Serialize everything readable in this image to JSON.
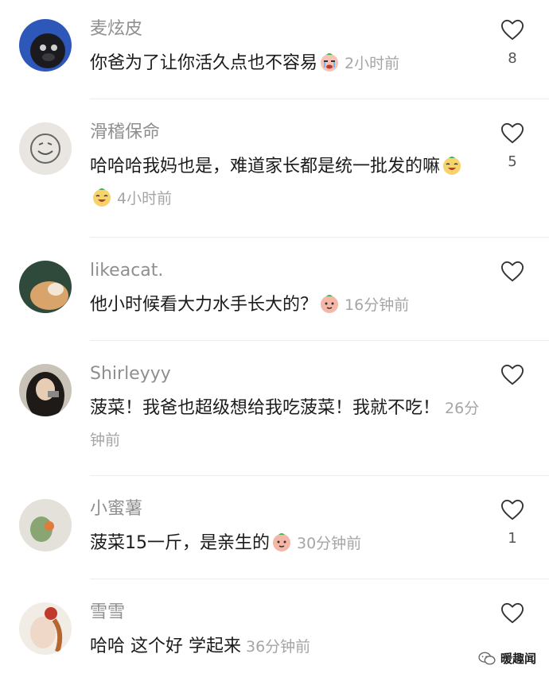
{
  "comments": [
    {
      "username": "麦炫皮",
      "text": "你爸为了让你活久点也不容易",
      "emoji": "crying-face-emoji",
      "time": "2小时前",
      "likes": "8"
    },
    {
      "username": "滑稽保命",
      "text": "哈哈哈我妈也是，难道家长都是统一批发的嘛",
      "emoji": "laughing-face-emoji",
      "time": "4小时前",
      "likes": "5"
    },
    {
      "username": "likeacat.",
      "text": "他小时候看大力水手长大的？",
      "emoji": "peach-face-emoji",
      "time": "16分钟前",
      "likes": ""
    },
    {
      "username": "Shirleyyy",
      "text": "菠菜！我爸也超级想给我吃菠菜！我就不吃！",
      "emoji": "",
      "time": "26分钟前",
      "likes": ""
    },
    {
      "username": "小蜜薯",
      "text": "菠菜15一斤，是亲生的",
      "emoji": "peach-face-emoji",
      "time": "30分钟前",
      "likes": "1"
    },
    {
      "username": "雪雪",
      "text": "哈哈 这个好 学起来",
      "emoji": "",
      "time": "36分钟前",
      "likes": ""
    }
  ],
  "watermark": "暖趣闻",
  "colors": {
    "username": "#8f8f8f",
    "text": "#1b1b1b",
    "time": "#a5a5a5",
    "divider": "#ececec"
  }
}
